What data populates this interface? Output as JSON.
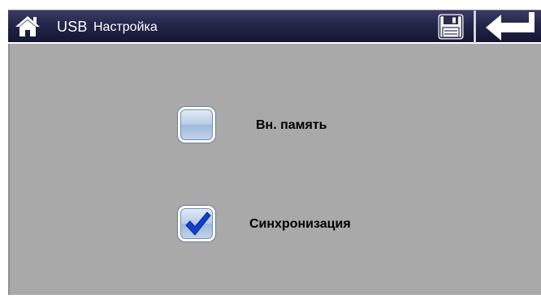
{
  "header": {
    "title_usb": "USB",
    "title_setting": "Настройка",
    "home_icon": "home-icon",
    "save_icon": "floppy-disk-icon",
    "back_icon": "return-arrow-icon"
  },
  "options": [
    {
      "label": "Вн. память",
      "checked": false
    },
    {
      "label": "Синхронизация",
      "checked": true
    }
  ],
  "colors": {
    "header_bg": "#23254a",
    "panel_bg": "#a9a9a9",
    "checkmark": "#1540c8"
  }
}
